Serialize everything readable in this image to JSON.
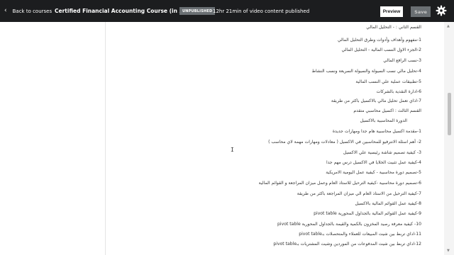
{
  "header": {
    "back_label": "Back to courses",
    "back_icon": "chevron-left-icon",
    "course_title": "Certified Financial Accounting Course (in Arabic)",
    "status_badge": "UNPUBLISHED",
    "content_status": "12hr 21min of video content published",
    "preview_label": "Preview",
    "save_label": "Save",
    "settings_icon": "gear-icon"
  },
  "colors": {
    "topbar_bg": "#1c1d1f",
    "badge_bg": "#6a6f73",
    "save_bg": "#6a6f73",
    "content_bg": "#ffffff"
  },
  "editor": {
    "lines": [
      "القسم الثاني : - التحليل المالي",
      "1-مفهوم وأهداف وأدوات وطرق التحليل المالي",
      "2-الجزء الاول النسب المالية - التحليل المالي",
      "3-نسب الرافع المالي",
      "4-تحليل مالي نسب السيولة والسيولة السريعة ونسب النشاط",
      "5-تطبيقات عملية علي النسب المالية",
      "6-ادارة النقدية بالشركات",
      "7-اذاي تعمل تحليل مالي بالاكسيل باكثر من طريقة",
      "القسم الثالث : اكسيل محاسبي متقدم",
      "الدورة المحاسبية بالاكسيل",
      "1-مقدمة اكسيل محاسبية هام جدا ومهارات جديدة",
      "2- أهم اسئلة الانترفيو للمحاسبين في الاكسيل ( معادلات ومهارات مهمة لاي محاسب )",
      "3- كيفية تصميم شاشة رئيسية علي الاكسيل",
      "4-كيفية عمل تثبيت الخلايا في الاكسيل درس مهم جدا",
      "5-تصميم دورة محاسبية - كيفية عمل اليومية الامريكية",
      "6-تصميم دورة محاسبية -كيفية الترحيل للاستاذ العام وعمل ميزان المراجعة و القوائم المالية",
      "7-كيفية الترحيل من الاستاذ العام الي ميزان المراجعة باكثر من طريقة",
      "8-كيفية عمل القوائم المالية بالاكسيل",
      "9-كيفية عمل القوائم المالية بالجداول المحورية pivot table",
      "10- كيفية معرفة رصيد المخزون بالكمية والقيمة بالجداول المحورية pivot table",
      "11-اذاي تربط بين شيت المبيعات للعملاء والمتحصلات بـpivot table",
      "12-اذاي تربط بين شيت المدفوعات من الموردين وشيت المشتريات بـpivot table"
    ]
  }
}
